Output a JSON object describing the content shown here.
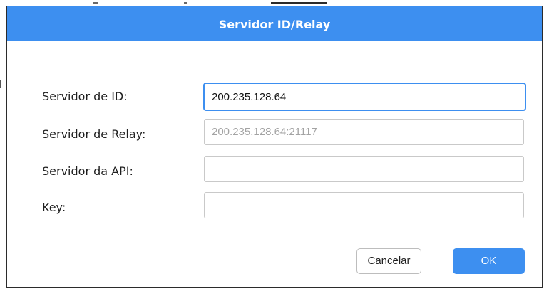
{
  "dialog": {
    "title": "Servidor ID/Relay",
    "fields": [
      {
        "label": "Servidor de ID:",
        "value": "200.235.128.64",
        "placeholder": ""
      },
      {
        "label": "Servidor de Relay:",
        "value": "",
        "placeholder": "200.235.128.64:21117"
      },
      {
        "label": "Servidor da API:",
        "value": "",
        "placeholder": ""
      },
      {
        "label": "Key:",
        "value": "",
        "placeholder": ""
      }
    ],
    "buttons": {
      "cancel_label": "Cancelar",
      "ok_label": "OK"
    }
  },
  "colors": {
    "accent": "#3d8ff0",
    "title_text": "#ffffff",
    "placeholder": "#a3a3a3",
    "border": "#c9c9c9"
  }
}
